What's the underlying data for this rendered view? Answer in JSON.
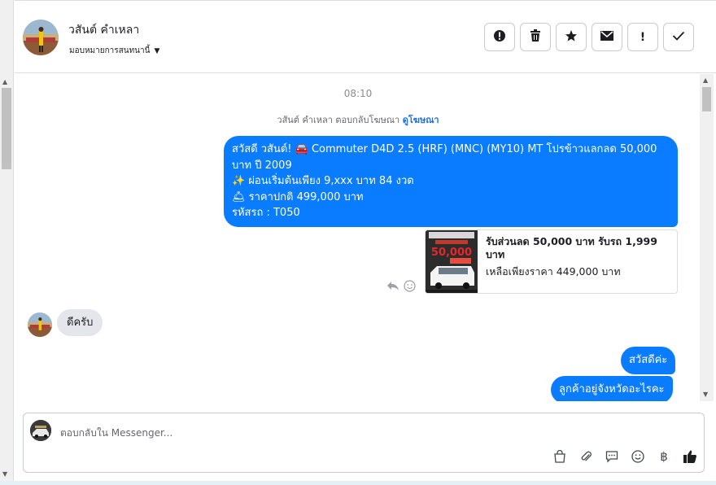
{
  "header": {
    "contact_name": "วสันต์ คำเหลา",
    "assign_label": "มอบหมายการสนทนานี้",
    "actions": [
      {
        "name": "spam-button",
        "glyph": "!"
      },
      {
        "name": "delete-button",
        "glyph": "🗑"
      },
      {
        "name": "star-button",
        "glyph": "★"
      },
      {
        "name": "mark-unread-button",
        "glyph": "✉"
      },
      {
        "name": "important-button",
        "glyph": "!"
      },
      {
        "name": "done-button",
        "glyph": "✓"
      }
    ]
  },
  "chat": {
    "timestamp": "08:10",
    "ad_reply_text": "วสันต์ คำเหลา ตอบกลับโฆษณา",
    "ad_link": "ดูโฆษณา",
    "first_message": {
      "line1": "สวัสดี วสันต์! 🚘 Commuter D4D 2.5 (HRF) (MNC) (MY10) MT โปรข้าวแลกลด 50,000",
      "line2": "บาท ปี 2009",
      "line3": "✨  ผ่อนเริ่มต้นเพียง 9,xxx บาท  84 งวด",
      "line4": "🛎  ราคาปกติ 499,000 บาท",
      "line5": "รหัสรถ : T050"
    },
    "ad_card": {
      "title": "รับส่วนลด 50,000 บาท รับรถ 1,999 บาท",
      "subtitle": "เหลือเพียงราคา 449,000 บาท",
      "thumb_price": "50,000"
    },
    "incoming": "ดีครับ",
    "reply1": "สวัสดีค่ะ",
    "reply2": "ลูกค้าอยู่จังหวัดอะไรคะ"
  },
  "composer": {
    "placeholder": "ตอบกลับใน Messenger..."
  },
  "colors": {
    "accent": "#0a7cff",
    "incoming_bubble": "#e4e6eb",
    "link": "#216fdb"
  }
}
